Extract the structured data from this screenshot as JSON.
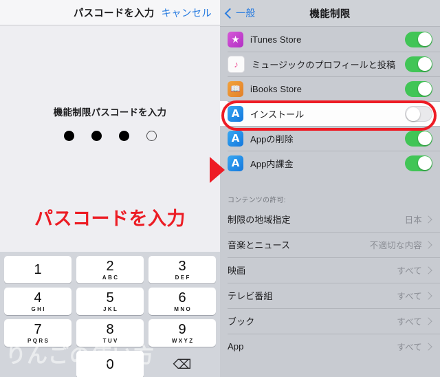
{
  "left_panel": {
    "nav": {
      "title": "パスコードを入力",
      "cancel_label": "キャンセル"
    },
    "prompt": "機能制限パスコードを入力",
    "dots": {
      "total": 4,
      "filled": 3
    },
    "callout_text": "パスコードを入力",
    "watermark": "りんごの使い方",
    "keypad": {
      "keys": [
        {
          "num": "1",
          "letters": ""
        },
        {
          "num": "2",
          "letters": "ABC"
        },
        {
          "num": "3",
          "letters": "DEF"
        },
        {
          "num": "4",
          "letters": "GHI"
        },
        {
          "num": "5",
          "letters": "JKL"
        },
        {
          "num": "6",
          "letters": "MNO"
        },
        {
          "num": "7",
          "letters": "PQRS"
        },
        {
          "num": "8",
          "letters": "TUV"
        },
        {
          "num": "9",
          "letters": "WXYZ"
        },
        {
          "num": "0",
          "letters": ""
        }
      ],
      "delete_glyph": "⌫"
    }
  },
  "right_panel": {
    "nav": {
      "back_label": "一般",
      "title": "機能制限"
    },
    "toggle_rows": [
      {
        "label": "iTunes Store",
        "icon": "itunes-star-icon",
        "glyph": "★",
        "state": "on",
        "highlighted": false
      },
      {
        "label": "ミュージックのプロフィールと投稿",
        "icon": "music-note-icon",
        "glyph": "♪",
        "state": "on",
        "highlighted": false
      },
      {
        "label": "iBooks Store",
        "icon": "ibooks-book-icon",
        "glyph": "📖",
        "state": "on",
        "highlighted": false
      },
      {
        "label": "インストール",
        "icon": "app-store-icon",
        "glyph": "A",
        "state": "off",
        "highlighted": true
      },
      {
        "label": "Appの削除",
        "icon": "app-store-icon",
        "glyph": "A",
        "state": "on",
        "highlighted": false
      },
      {
        "label": "App内課金",
        "icon": "app-store-icon",
        "glyph": "A",
        "state": "on",
        "highlighted": false
      }
    ],
    "section_header": "コンテンツの許可:",
    "nav_rows": [
      {
        "label": "制限の地域指定",
        "value": "日本"
      },
      {
        "label": "音楽とニュース",
        "value": "不適切な内容"
      },
      {
        "label": "映画",
        "value": "すべて"
      },
      {
        "label": "テレビ番組",
        "value": "すべて"
      },
      {
        "label": "ブック",
        "value": "すべて"
      },
      {
        "label": "App",
        "value": "すべて"
      }
    ]
  },
  "annotation": {
    "arrow_color": "#ee1c25",
    "highlight_color": "#ee1c25"
  }
}
